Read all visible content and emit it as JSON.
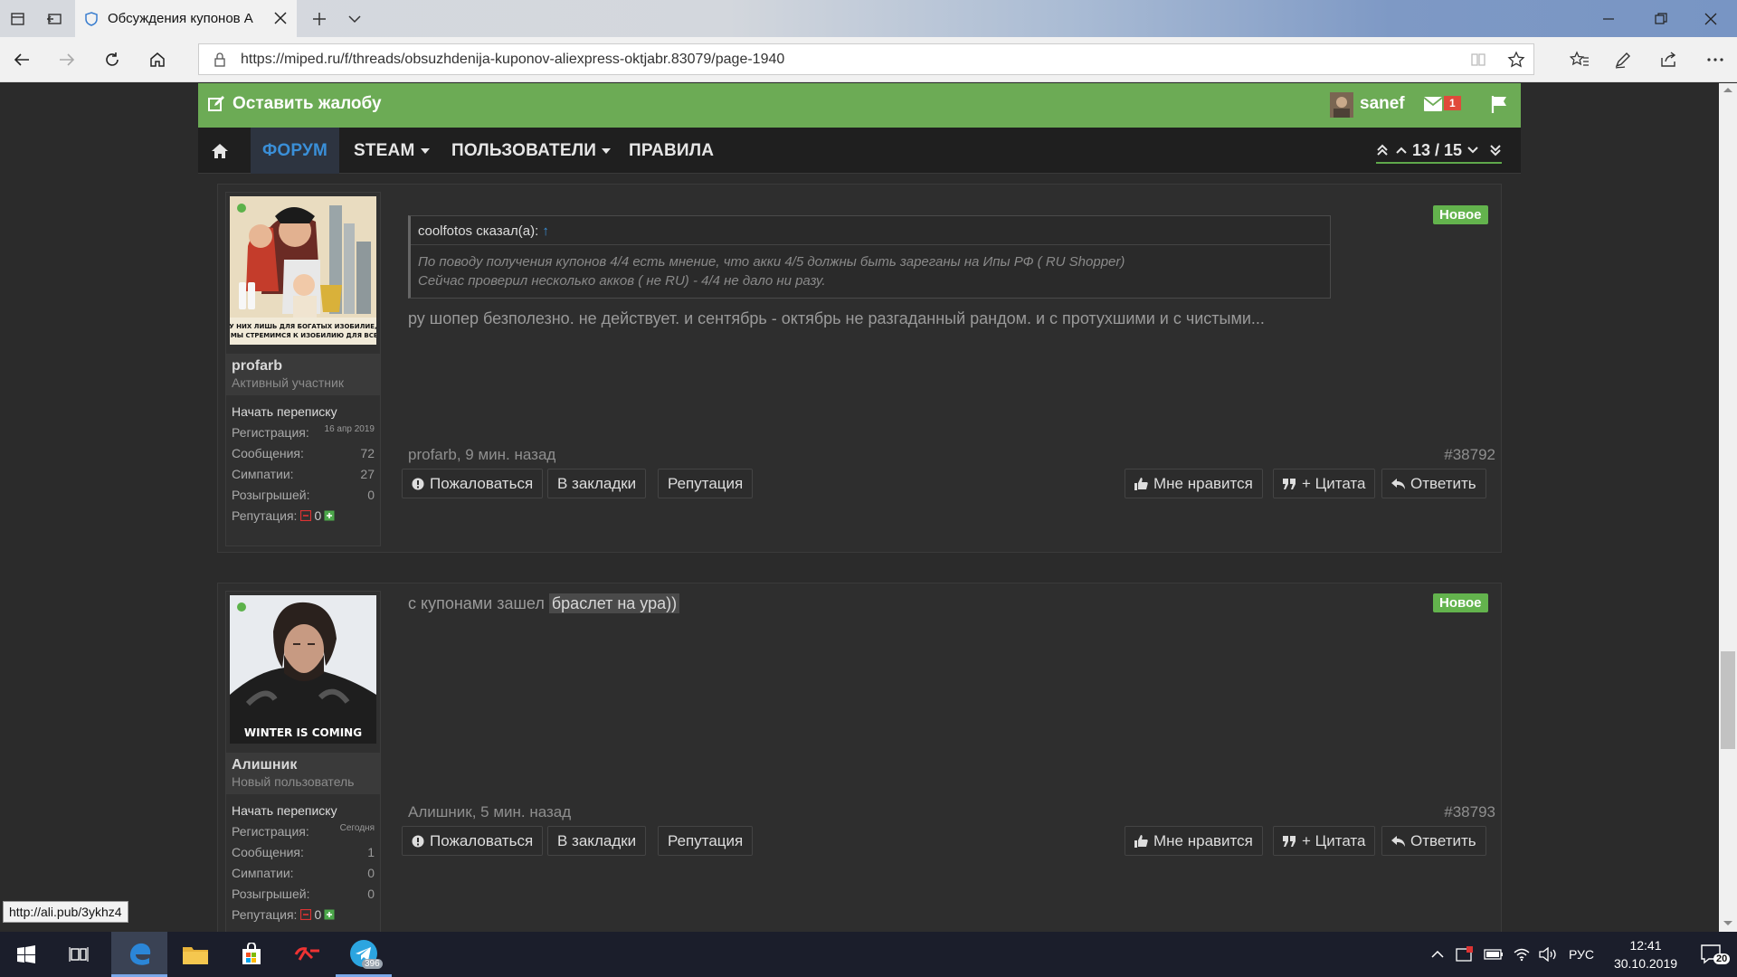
{
  "browser": {
    "tab_title": "Обсуждения купонов А",
    "url": "https://miped.ru/f/threads/obsuzhdenija-kuponov-aliexpress-oktjabr.83079/page-1940",
    "status_url": "http://ali.pub/3ykhz4"
  },
  "site": {
    "complaint_label": "Оставить жалобу",
    "username": "sanef",
    "messages_count": "1",
    "menu": {
      "forum": "ФОРУМ",
      "steam": "STEAM",
      "users": "ПОЛЬЗОВАТЕЛИ",
      "rules": "ПРАВИЛА"
    },
    "pagination": "13 / 15"
  },
  "posts": [
    {
      "author": "profarb",
      "user_title": "Активный участник",
      "start_conversation": "Начать переписку",
      "stats": [
        {
          "label": "Регистрация:",
          "value": "16 апр 2019"
        },
        {
          "label": "Сообщения:",
          "value": "72"
        },
        {
          "label": "Симпатии:",
          "value": "27"
        },
        {
          "label": "Розыгрышей:",
          "value": "0"
        }
      ],
      "reputation_label": "Репутация:",
      "reputation_value": "0",
      "avatar_caption_1": "У НИХ ЛИШЬ ДЛЯ БОГАТЫХ ИЗОБИЛИЕ,",
      "avatar_caption_2": "А МЫ СТРЕМИМСЯ К ИЗОБИЛИЮ ДЛЯ ВСЕХ",
      "badge": "Новое",
      "quote_header": "coolfotos сказал(а):",
      "quote_arrow": "↑",
      "quote_line1": "По поводу получения купонов 4/4 есть мнение, что акки 4/5 должны быть зареганы на Ипы РФ ( RU Shopper)",
      "quote_line2": "Сейчас проверил несколько акков ( не RU) - 4/4 не дало ни разу.",
      "message": "ру шопер безполезно. не действует. и сентябрь - октябрь не разгаданный рандом. и с протухшими и с чистыми...",
      "meta": "profarb, 9 мин. назад",
      "post_number": "#38792"
    },
    {
      "author": "Алишник",
      "user_title": "Новый пользователь",
      "start_conversation": "Начать переписку",
      "stats": [
        {
          "label": "Регистрация:",
          "value": "Сегодня"
        },
        {
          "label": "Сообщения:",
          "value": "1"
        },
        {
          "label": "Симпатии:",
          "value": "0"
        },
        {
          "label": "Розыгрышей:",
          "value": "0"
        }
      ],
      "reputation_label": "Репутация:",
      "reputation_value": "0",
      "avatar_caption_1": "WINTER IS COMING",
      "badge": "Новое",
      "message_prefix": "с купонами зашел",
      "message_link": "браслет на ура))",
      "meta": "Алишник, 5 мин. назад",
      "post_number": "#38793"
    }
  ],
  "actions": {
    "report": "Пожаловаться",
    "bookmark": "В закладки",
    "reputation": "Репутация",
    "like": "Мне нравится",
    "quote": "+ Цитата",
    "reply": "Ответить"
  },
  "taskbar": {
    "telegram_badge": "396",
    "language": "РУС",
    "time": "12:41",
    "date": "30.10.2019",
    "notifications": "20"
  },
  "colors": {
    "green_bar": "#6cab55",
    "menu_active": "#3a8fd8",
    "new_badge": "#63b34d",
    "message_badge": "#e04a3a"
  }
}
